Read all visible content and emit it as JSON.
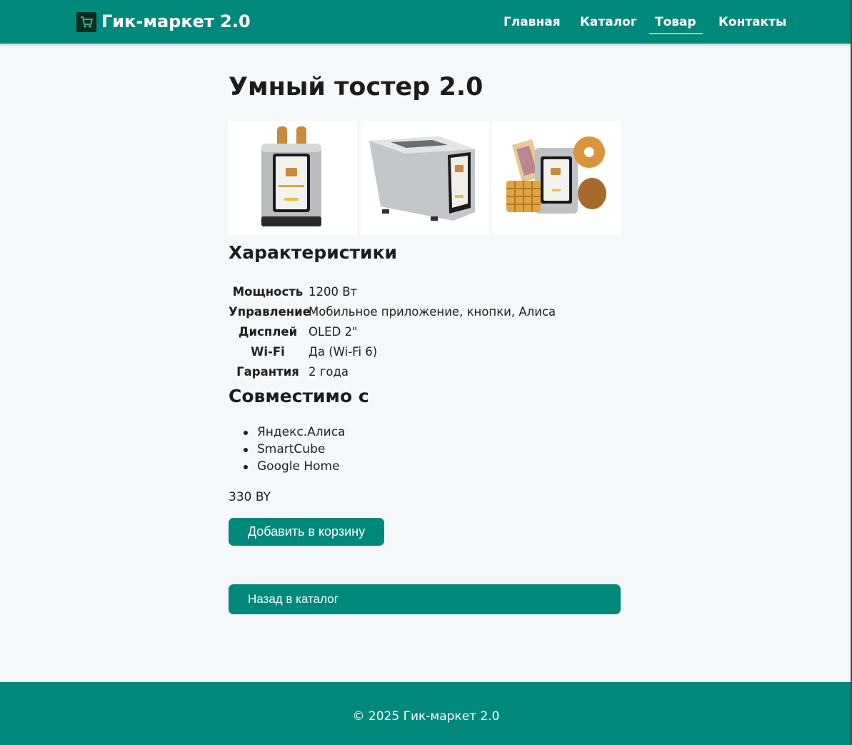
{
  "header": {
    "brand": "Гик-маркет 2.0",
    "nav": [
      {
        "label": "Главная"
      },
      {
        "label": "Каталог"
      },
      {
        "label": "Товар",
        "active": true
      },
      {
        "label": "Контакты"
      }
    ]
  },
  "product": {
    "title": "Умный тостер 2.0",
    "images": [
      "toaster-front",
      "toaster-side",
      "toaster-with-pastries"
    ],
    "specs_title": "Характеристики",
    "specs": [
      {
        "name": "Мощность",
        "value": "1200 Вт"
      },
      {
        "name": "Управление",
        "value": "Мобильное приложение, кнопки, Алиса"
      },
      {
        "name": "Дисплей",
        "value": "OLED 2\""
      },
      {
        "name": "Wi-Fi",
        "value": "Да (Wi-Fi 6)"
      },
      {
        "name": "Гарантия",
        "value": "2 года"
      }
    ],
    "compat_title": "Совместимо с",
    "compat": [
      "Яндекс.Алиса",
      "SmartCube",
      "Google Home"
    ],
    "price": "330 BY",
    "add_to_cart_label": "Добавить в корзину",
    "back_label": "Назад в каталог"
  },
  "footer": {
    "text": "© 2025 Гик-маркет 2.0"
  },
  "colors": {
    "brand": "#00897b",
    "accent": "#f5c518",
    "background": "#f4f8fb"
  }
}
